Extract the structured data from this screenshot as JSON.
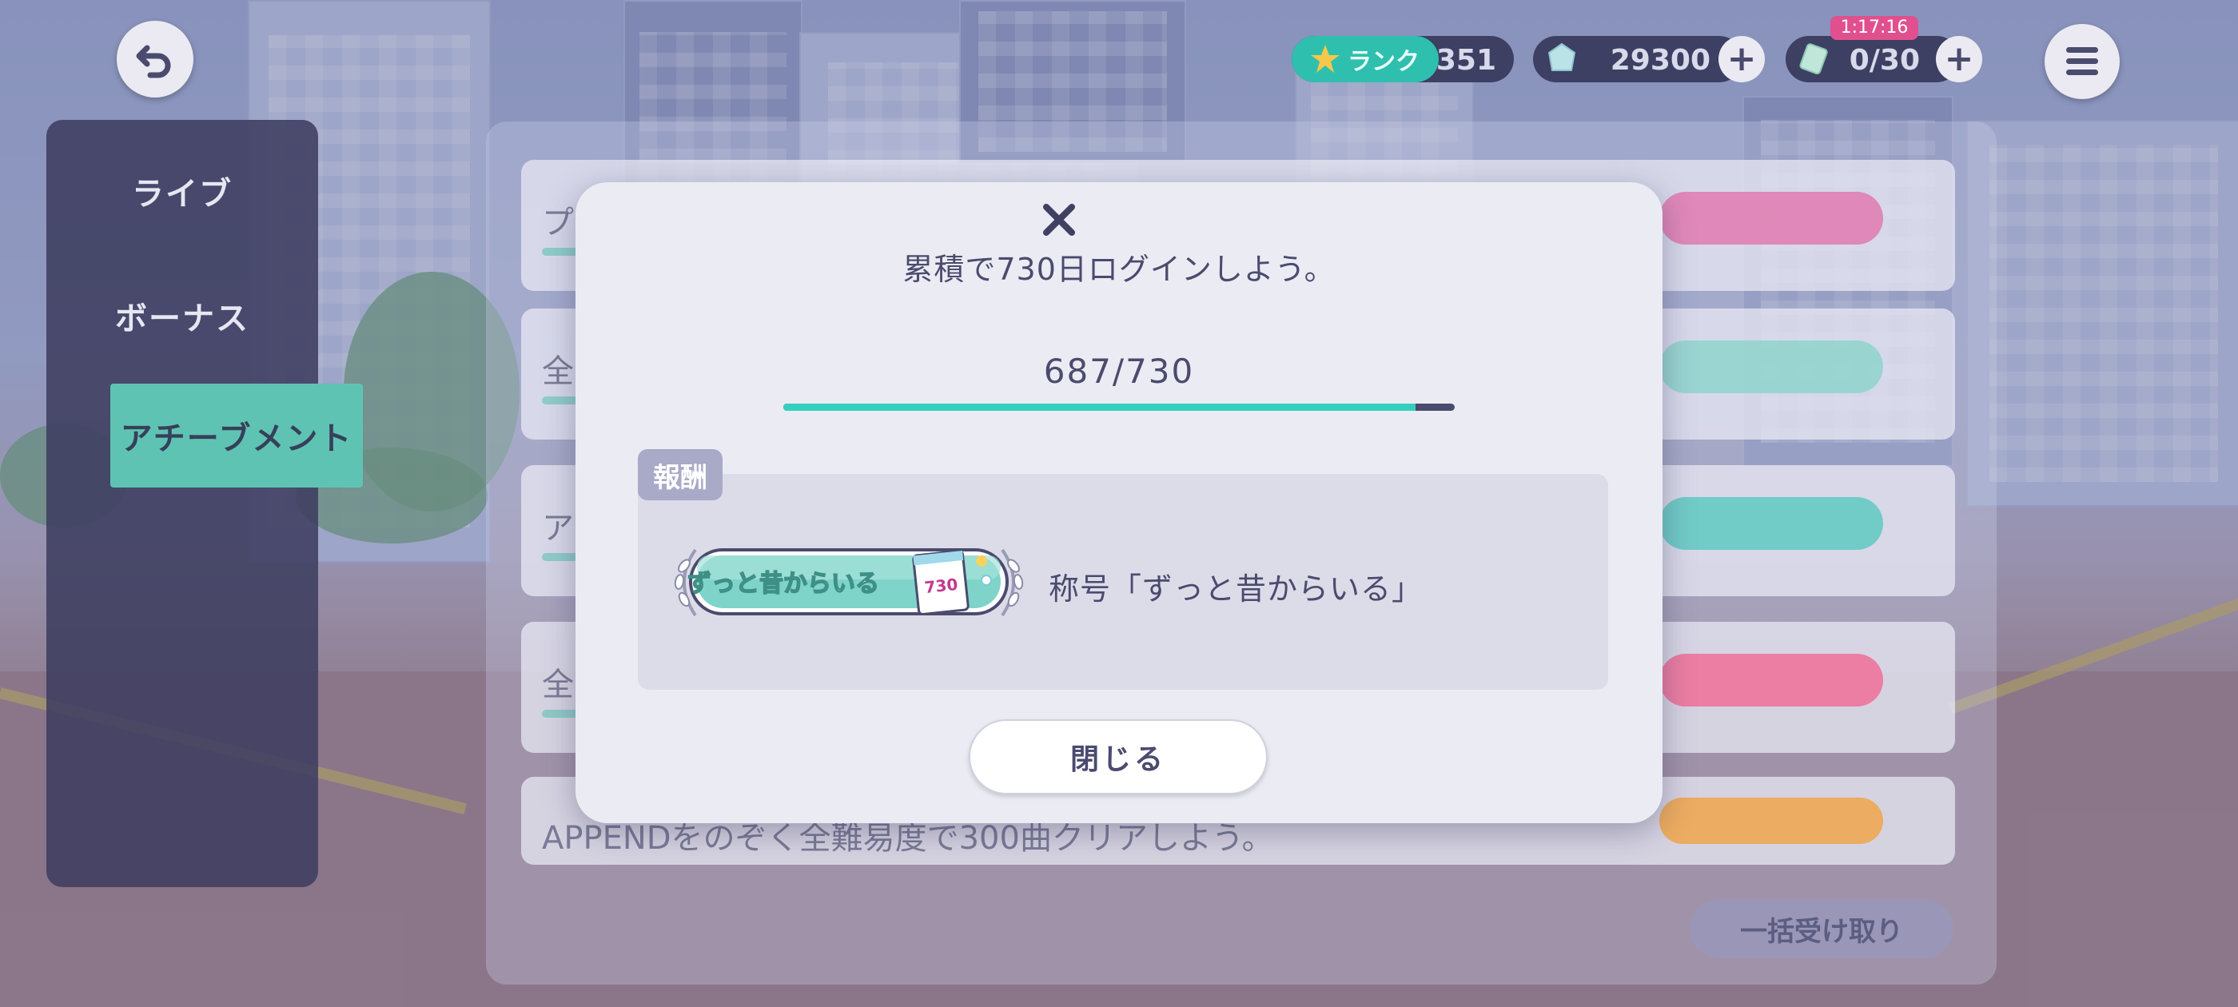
{
  "hud": {
    "rank_label": "ランク",
    "rank_value": "351",
    "crystal_value": "29300",
    "stamina_value": "0/30",
    "stamina_timer_badge": "1:17:16"
  },
  "sidebar": {
    "items": [
      {
        "label": "ライブ"
      },
      {
        "label": "ボーナス"
      },
      {
        "label": "アチーブメント"
      }
    ]
  },
  "list": {
    "visible_row_text": "APPENDをのぞく全難易度で300曲クリアしよう。",
    "row_prefixes": [
      "プ",
      "全",
      "ア",
      "全"
    ],
    "bulk_receive_label": "一括受け取り"
  },
  "modal": {
    "title": "累積で730日ログインしよう。",
    "progress": {
      "current": 687,
      "goal": 730,
      "text": "687/730"
    },
    "reward_tag": "報酬",
    "reward_badge_text": "ずっと昔からいる",
    "reward_badge_number": "730",
    "reward_name": "称号「ずっと昔からいる」",
    "close_label": "閉じる"
  },
  "colors": {
    "accent": "#33d0bd",
    "text": "#4a4b6e",
    "modal_bg": "#ebebf3",
    "reward_box_bg": "#dcdce9"
  }
}
